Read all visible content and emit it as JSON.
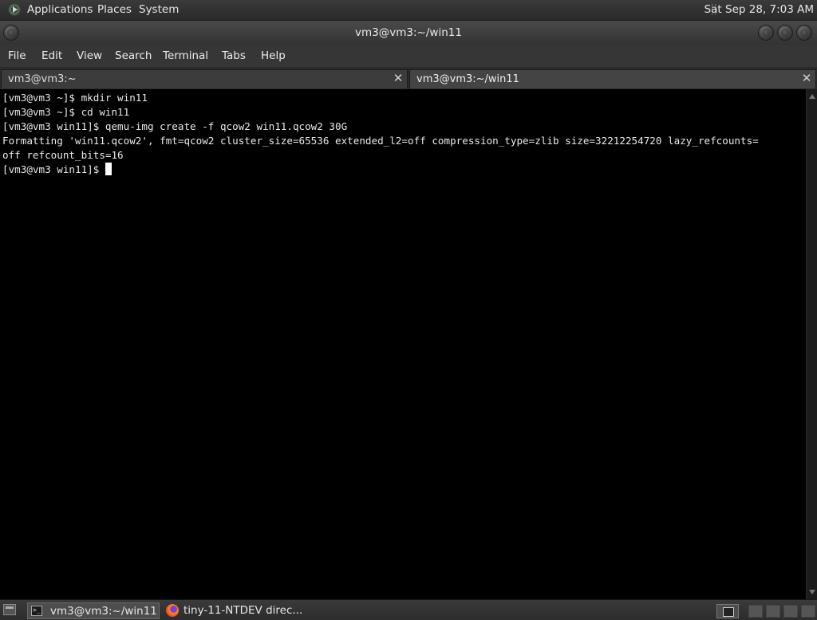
{
  "top_panel": {
    "menus": [
      "Applications",
      "Places",
      "System"
    ],
    "clock": "Sat Sep 28,  7:03 AM"
  },
  "window": {
    "title": "vm3@vm3:~/win11"
  },
  "menubar": {
    "items": [
      "File",
      "Edit",
      "View",
      "Search",
      "Terminal",
      "Tabs",
      "Help"
    ]
  },
  "tabs": [
    {
      "label": "vm3@vm3:~",
      "active": false
    },
    {
      "label": "vm3@vm3:~/win11",
      "active": true
    }
  ],
  "terminal": {
    "lines": [
      "[vm3@vm3 ~]$ mkdir win11",
      "[vm3@vm3 ~]$ cd win11",
      "[vm3@vm3 win11]$ qemu-img create -f qcow2 win11.qcow2 30G",
      "Formatting 'win11.qcow2', fmt=qcow2 cluster_size=65536 extended_l2=off compression_type=zlib size=32212254720 lazy_refcounts=",
      "off refcount_bits=16"
    ],
    "prompt": "[vm3@vm3 win11]$ "
  },
  "taskbar": {
    "tasks": [
      {
        "label": "vm3@vm3:~/win11",
        "icon": "terminal-icon",
        "active": true
      },
      {
        "label": "tiny-11-NTDEV direc...",
        "icon": "firefox-icon",
        "active": false
      }
    ]
  },
  "colors": {
    "panel": "#2f2f2f",
    "terminal_bg": "#000000",
    "terminal_fg": "#e8e8e8"
  }
}
